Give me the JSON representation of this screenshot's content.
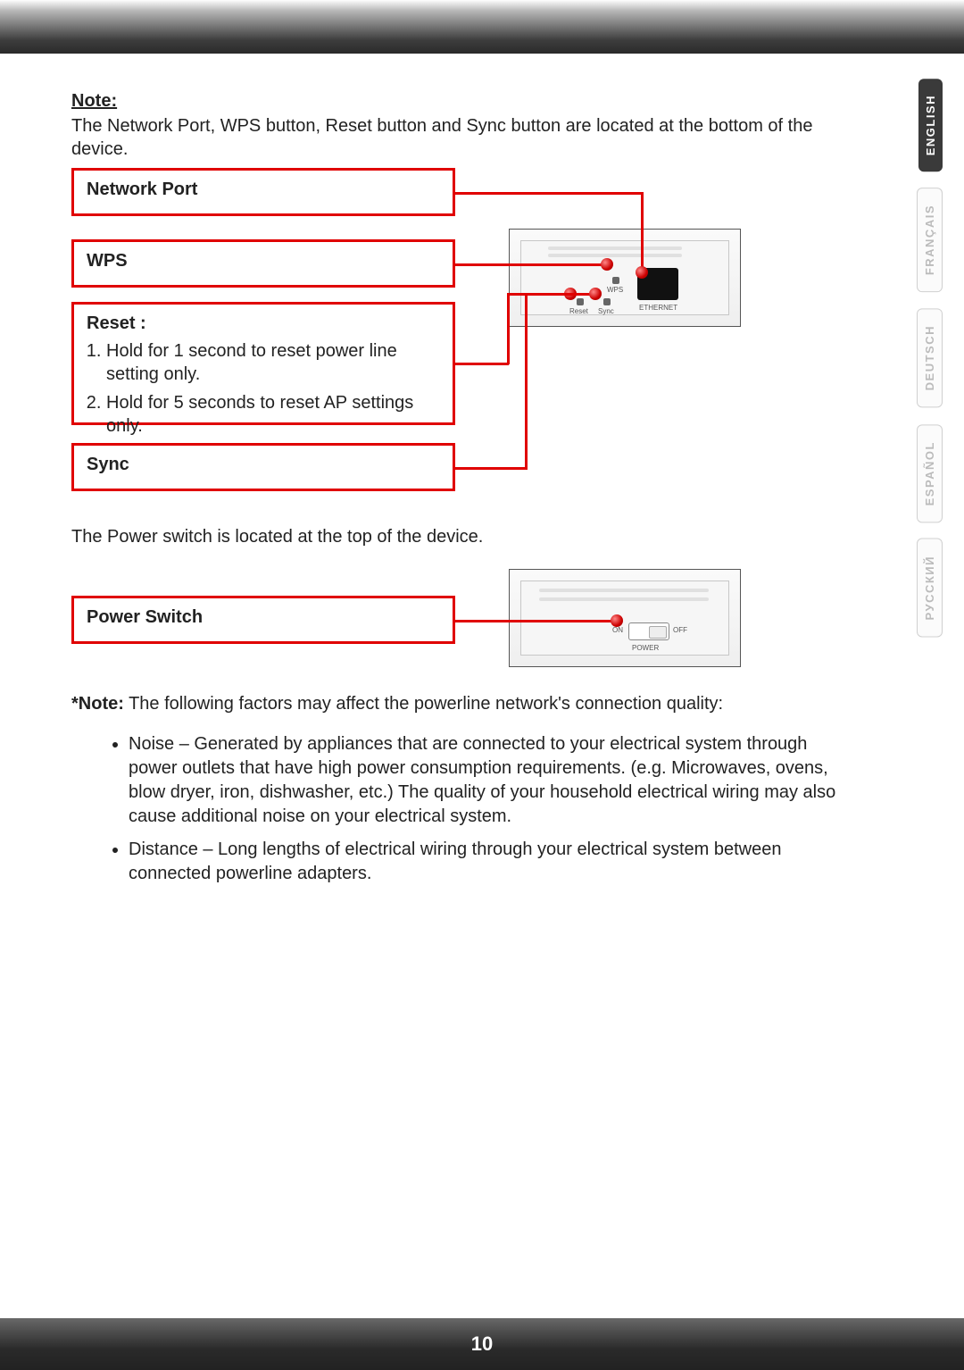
{
  "page_number": "10",
  "languages": {
    "active": "ENGLISH",
    "others": [
      "FRANÇAIS",
      "DEUTSCH",
      "ESPAÑOL",
      "РУССКИЙ"
    ]
  },
  "note": {
    "heading": "Note:",
    "body": "The Network Port, WPS button, Reset button and Sync button are located at the bottom of the device."
  },
  "callouts": {
    "network_port": "Network Port",
    "wps": "WPS",
    "reset_title": "Reset :",
    "reset_item1": "Hold for 1 second to reset power line setting only.",
    "reset_item2": "Hold for 5 seconds to reset AP settings only.",
    "sync": "Sync"
  },
  "device_labels": {
    "wps": "WPS",
    "reset": "Reset",
    "sync": "Sync",
    "ethernet": "ETHERNET",
    "power": "POWER",
    "on": "ON",
    "off": "OFF"
  },
  "power_section": {
    "intro": "The Power switch is located at the top of the device.",
    "label": "Power Switch"
  },
  "footnote": {
    "lead_bold": "*Note:",
    "lead_rest": " The following factors may affect the powerline network's connection quality:",
    "bullet1": "Noise – Generated by appliances that are connected to your electrical system through power outlets that have high power consumption requirements. (e.g. Microwaves, ovens, blow dryer, iron, dishwasher, etc.) The quality of your household electrical wiring may also cause additional noise on your electrical system.",
    "bullet2": "Distance – Long lengths of electrical wiring through your electrical system between connected powerline adapters."
  }
}
